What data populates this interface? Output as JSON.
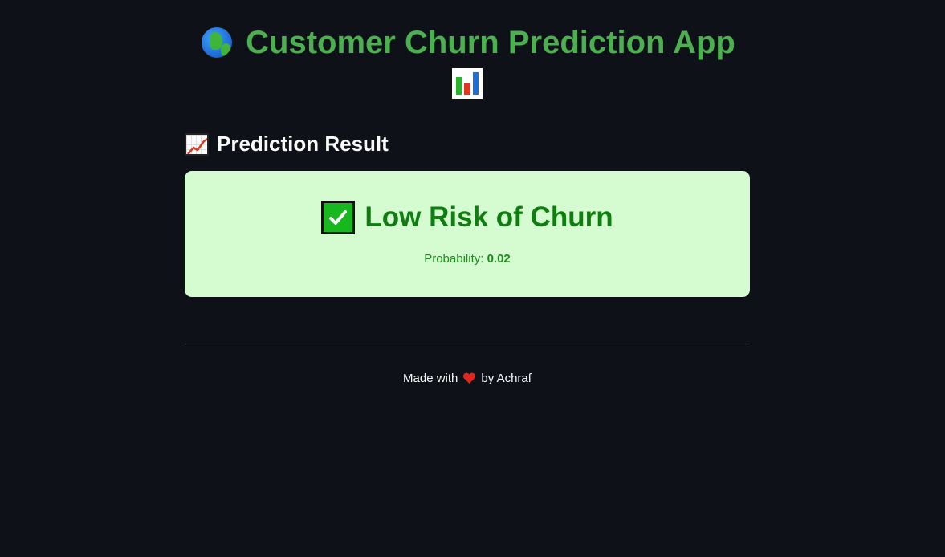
{
  "app": {
    "title": "Customer Churn Prediction App",
    "title_icons": [
      "globe-icon",
      "bar-chart-icon"
    ]
  },
  "section": {
    "title": "Prediction Result",
    "icon": "chart-increasing-icon"
  },
  "result": {
    "icon": "check-mark-icon",
    "label": "Low Risk of Churn",
    "probability_label": "Probability:",
    "probability_value": "0.02",
    "colors": {
      "background": "#d4fcd0",
      "text": "#0f7d0f"
    }
  },
  "footer": {
    "prefix": "Made with",
    "icon": "heart-icon",
    "suffix": "by Achraf"
  },
  "theme": {
    "background": "#0e1117",
    "accent": "#4caf50"
  }
}
